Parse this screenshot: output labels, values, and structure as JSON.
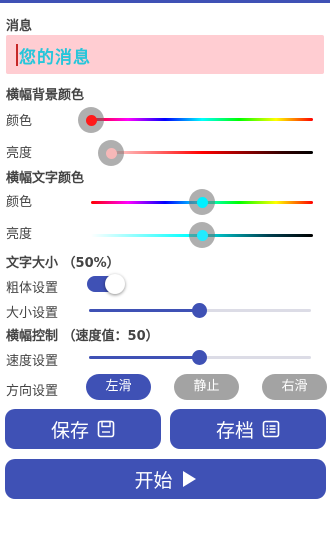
{
  "message": {
    "label": "消息",
    "value": "您的消息",
    "text_color": "#26c6da",
    "background_color": "#ffcdd2"
  },
  "banner_background": {
    "title": "横幅背景颜色",
    "color_label": "颜色",
    "color_value": 0.0,
    "brightness_label": "亮度",
    "brightness_value": 0.12
  },
  "banner_text": {
    "title": "横幅文字颜色",
    "color_label": "颜色",
    "color_value": 0.5,
    "brightness_label": "亮度",
    "brightness_value": 0.5
  },
  "text_size": {
    "title": "文字大小 （50%）",
    "bold_label": "粗体设置",
    "bold_on": true,
    "size_label": "大小设置",
    "size_value": 0.5
  },
  "banner_control": {
    "title": "横幅控制 （速度值：50）",
    "speed_label": "速度设置",
    "speed_value": 0.5,
    "direction_label": "方向设置",
    "directions": [
      "左滑",
      "静止",
      "右滑"
    ],
    "selected_direction": "左滑"
  },
  "buttons": {
    "save": "保存",
    "archive": "存档",
    "start": "开始"
  },
  "colors": {
    "accent": "#3f51b5",
    "pill_inactive": "#a3a3a3",
    "bg_color_swatch": "#ff1a1a",
    "bg_brightness_swatch": "#f6b8b8",
    "text_color_swatch": "#00f0ff",
    "text_brightness_swatch": "#22eaff"
  }
}
